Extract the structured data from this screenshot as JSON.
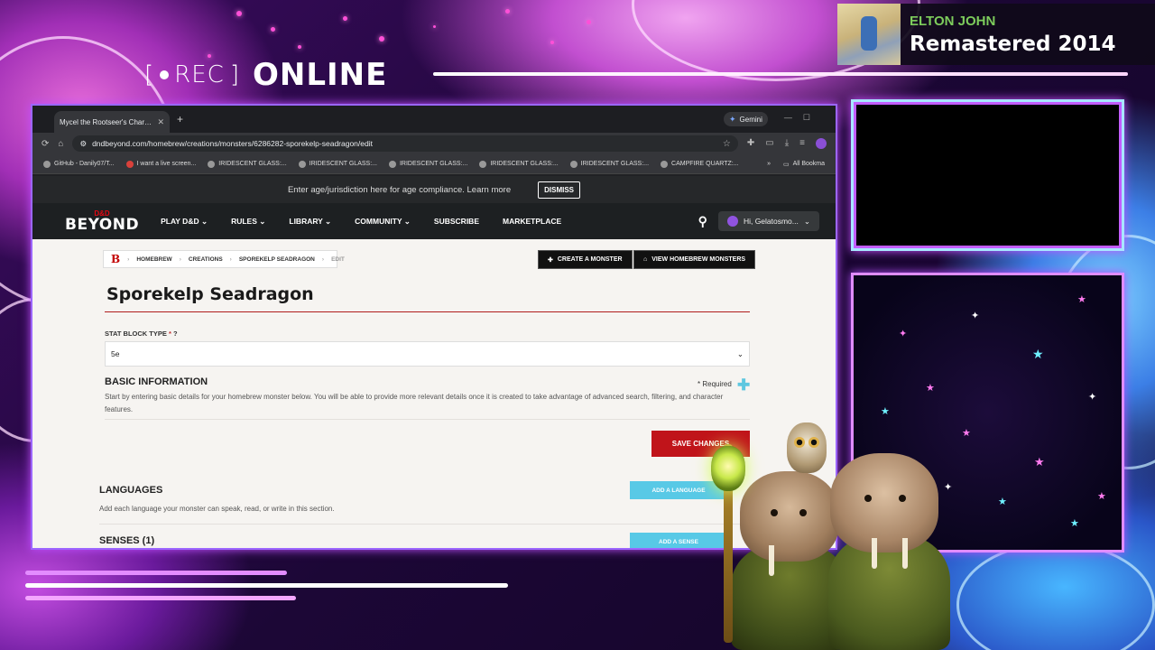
{
  "overlay": {
    "rec_label": "REC",
    "status_label": "ONLINE",
    "now_playing": {
      "artist": "ELTON JOHN",
      "title": "Remastered 2014"
    }
  },
  "browser": {
    "tab": {
      "title": "Mycel the Rootseer's Character",
      "close": "✕"
    },
    "new_tab": "+",
    "gemini_label": "Gemini",
    "url": "dndbeyond.com/homebrew/creations/monsters/6286282-sporekelp-seadragon/edit",
    "bookmarks": [
      "GitHub - Danily07/T...",
      "I want a live screen...",
      "IRIDESCENT GLASS:...",
      "IRIDESCENT GLASS:...",
      "IRIDESCENT GLASS:...",
      "IRIDESCENT GLASS:...",
      "IRIDESCENT GLASS:...",
      "CAMPFIRE QUARTZ:..."
    ],
    "bookmarks_overflow": "»",
    "all_bookmarks": "All Bookma"
  },
  "site": {
    "age_text": "Enter age/jurisdiction here for age compliance. Learn more",
    "dismiss": "DISMISS",
    "logo_top": "D&D",
    "logo_text": "BEYOND",
    "nav": [
      "PLAY D&D",
      "RULES",
      "LIBRARY",
      "COMMUNITY",
      "SUBSCRIBE",
      "MARKETPLACE"
    ],
    "user_greeting": "Hi, Gelatosmo...",
    "breadcrumb": {
      "logo": "B",
      "items": [
        "HOMEBREW",
        "CREATIONS",
        "SPOREKELP SEADRAGON",
        "EDIT"
      ]
    },
    "create_monster": "CREATE A MONSTER",
    "view_homebrew": "VIEW HOMEBREW MONSTERS",
    "page_title": "Sporekelp Seadragon",
    "stat_block_label": "STAT BLOCK TYPE",
    "stat_block_value": "5e",
    "basic_info_title": "BASIC INFORMATION",
    "required_note": "* Required",
    "basic_info_desc": "Start by entering basic details for your homebrew monster below. You will be able to provide more relevant details once it is created to take advantage of advanced search, filtering, and character features.",
    "save_changes": "SAVE CHANGES",
    "languages_title": "LANGUAGES",
    "languages_desc": "Add each language your monster can speak, read, or write in this section.",
    "add_language": "ADD A LANGUAGE",
    "senses_title": "SENSES (1)",
    "add_sense": "ADD A SENSE"
  },
  "colors": {
    "accent_red": "#c0141a",
    "accent_cyan": "#58c9e6",
    "np_artist": "#7dcc5c"
  }
}
